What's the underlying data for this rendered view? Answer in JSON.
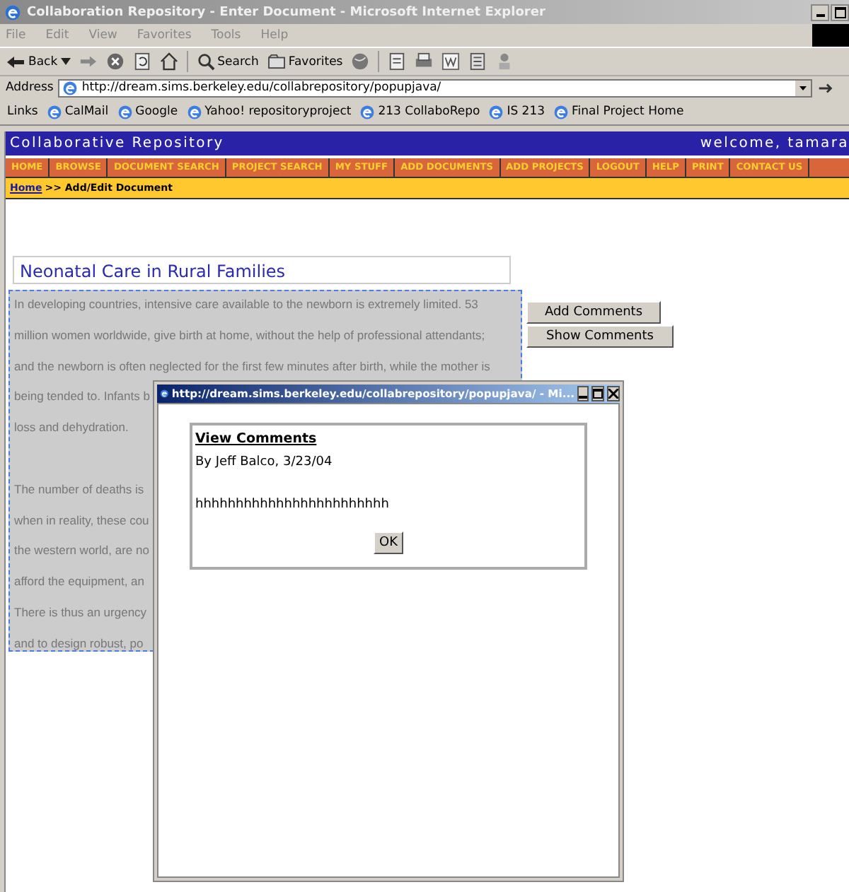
{
  "window": {
    "title": "Collaboration Repository - Enter Document - Microsoft Internet Explorer"
  },
  "menu": [
    "File",
    "Edit",
    "View",
    "Favorites",
    "Tools",
    "Help"
  ],
  "toolbar": {
    "back": "Back",
    "search": "Search",
    "favorites": "Favorites"
  },
  "address": {
    "label": "Address",
    "url": "http://dream.sims.berkeley.edu/collabrepository/popupjava/"
  },
  "links": {
    "label": "Links",
    "items": [
      "CalMail",
      "Google",
      "Yahoo! repositoryproject",
      "213 CollaboRepo",
      "IS 213",
      "Final Project Home"
    ]
  },
  "site": {
    "title": "Collaborative Repository",
    "welcome": "welcome, tamara"
  },
  "nav": [
    "HOME",
    "BROWSE",
    "DOCUMENT SEARCH",
    "PROJECT SEARCH",
    "MY STUFF",
    "ADD DOCUMENTS",
    "ADD PROJECTS",
    "LOGOUT",
    "HELP",
    "PRINT",
    "CONTACT US"
  ],
  "breadcrumb": {
    "link": "Home",
    "rest": ">> Add/Edit Document"
  },
  "document": {
    "title": "Neonatal Care in Rural Families",
    "paragraphs": [
      [
        "In developing countries, intensive care available to the newborn is extremely limited. 53",
        "million women worldwide, give birth at home, without the help of professional attendants;",
        "and the newborn is often neglected for the first few minutes after birth, while the mother is",
        "being tended to. Infants b",
        "loss and dehydration."
      ],
      [
        "The number of deaths is",
        "when in reality, these cou",
        "the western world, are no",
        "afford the equipment, an",
        "There is thus an urgency",
        "and to design robust, po"
      ]
    ]
  },
  "buttons": [
    "Add Comments",
    "Show Comments"
  ],
  "popup": {
    "title": "http://dream.sims.berkeley.edu/collabrepository/popupjava/ - Mi...",
    "heading": "View Comments",
    "byline": "By Jeff Balco, 3/23/04",
    "comment": "hhhhhhhhhhhhhhhhhhhhhhhh",
    "ok": "OK"
  }
}
